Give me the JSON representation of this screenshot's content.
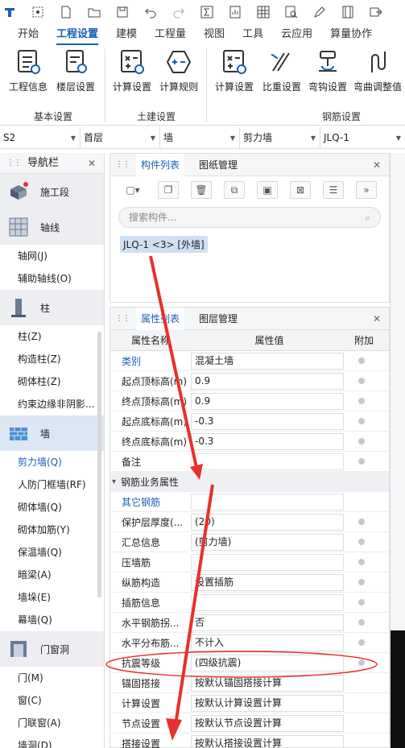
{
  "quickbar": {
    "icons": [
      "app-logo-icon",
      "select-icon",
      "new-file-icon",
      "open-folder-icon",
      "save-icon",
      "undo-icon",
      "redo-icon",
      "formula-icon",
      "report-icon",
      "grid-icon",
      "search-doc-icon",
      "pen-icon",
      "film-icon",
      "export-icon"
    ]
  },
  "menu": {
    "tabs": [
      "开始",
      "工程设置",
      "建模",
      "工程量",
      "视图",
      "工具",
      "云应用",
      "算量协作"
    ],
    "active": "工程设置"
  },
  "ribbon": {
    "buttons": [
      "工程信息",
      "楼层设置",
      "计算设置",
      "计算规则",
      "计算设置",
      "比重设置",
      "弯钩设置",
      "弯曲调整值"
    ],
    "groups": [
      "基本设置",
      "土建设置",
      "钢筋设置"
    ]
  },
  "selectors": [
    "S2",
    "首层",
    "墙",
    "剪力墙",
    "JLQ-1"
  ],
  "nav": {
    "title": "导航栏",
    "items": [
      {
        "type": "cat",
        "label": "施工段",
        "icon": "construction-stage-icon"
      },
      {
        "type": "cat",
        "label": "轴线",
        "icon": "axis-grid-icon"
      },
      {
        "type": "sub",
        "label": "轴网(J)"
      },
      {
        "type": "sub",
        "label": "辅助轴线(O)"
      },
      {
        "type": "cat",
        "label": "柱",
        "icon": "column-icon"
      },
      {
        "type": "sub",
        "label": "柱(Z)"
      },
      {
        "type": "sub",
        "label": "构造柱(Z)"
      },
      {
        "type": "sub",
        "label": "砌体柱(Z)"
      },
      {
        "type": "sub",
        "label": "约束边缘非阴影..."
      },
      {
        "type": "cat",
        "label": "墙",
        "icon": "wall-icon",
        "active": true
      },
      {
        "type": "sub",
        "label": "剪力墙(Q)",
        "active": true
      },
      {
        "type": "sub",
        "label": "人防门框墙(RF)"
      },
      {
        "type": "sub",
        "label": "砌体墙(Q)"
      },
      {
        "type": "sub",
        "label": "砌体加筋(Y)"
      },
      {
        "type": "sub",
        "label": "保温墙(Q)"
      },
      {
        "type": "sub",
        "label": "暗梁(A)"
      },
      {
        "type": "sub",
        "label": "墙垛(E)"
      },
      {
        "type": "sub",
        "label": "幕墙(Q)"
      },
      {
        "type": "cat",
        "label": "门窗洞",
        "icon": "door-window-icon"
      },
      {
        "type": "sub",
        "label": "门(M)"
      },
      {
        "type": "sub",
        "label": "窗(C)"
      },
      {
        "type": "sub",
        "label": "门联窗(A)"
      },
      {
        "type": "sub",
        "label": "墙洞(D)"
      }
    ]
  },
  "complist": {
    "tabs": [
      "构件列表",
      "图纸管理"
    ],
    "search_placeholder": "搜索构件...",
    "item": "JLQ-1 <3> [外墙]"
  },
  "props": {
    "tabs": [
      "属性列表",
      "图层管理"
    ],
    "headers": [
      "属性名称",
      "属性值",
      "附加"
    ],
    "rows": [
      {
        "name": "类别",
        "value": "混凝土墙",
        "link": true,
        "dot": true
      },
      {
        "name": "起点顶标高(m)",
        "value": "0.9",
        "dot": true
      },
      {
        "name": "终点顶标高(m)",
        "value": "0.9",
        "dot": true
      },
      {
        "name": "起点底标高(m)",
        "value": "-0.3",
        "dot": true
      },
      {
        "name": "终点底标高(m)",
        "value": "-0.3",
        "dot": true
      },
      {
        "name": "备注",
        "value": "",
        "dot": true
      },
      {
        "section": "钢筋业务属性"
      },
      {
        "name": "其它钢筋",
        "value": "",
        "link": true,
        "dot": false
      },
      {
        "name": "保护层厚度(...",
        "value": "(20)",
        "dot": true
      },
      {
        "name": "汇总信息",
        "value": "(剪力墙)",
        "dot": true
      },
      {
        "name": "压墙筋",
        "value": "",
        "dot": true
      },
      {
        "name": "纵筋构造",
        "value": "设置插筋",
        "dot": true
      },
      {
        "name": "插筋信息",
        "value": "",
        "dot": true
      },
      {
        "name": "水平钢筋拐...",
        "value": "否",
        "dot": true
      },
      {
        "name": "水平分布筋...",
        "value": "不计入",
        "dot": true
      },
      {
        "name": "抗震等级",
        "value": "(四级抗震)",
        "dot": true
      },
      {
        "name": "锚固搭接",
        "value": "按默认锚固搭接计算",
        "dot": false
      },
      {
        "name": "计算设置",
        "value": "按默认计算设置计算",
        "dot": false
      },
      {
        "name": "节点设置",
        "value": "按默认节点设置计算",
        "dot": false
      },
      {
        "name": "搭接设置",
        "value": "按默认搭接设置计算",
        "dot": false
      }
    ]
  },
  "colors": {
    "accent": "#1a5fb4",
    "arrow": "#e8302a"
  }
}
